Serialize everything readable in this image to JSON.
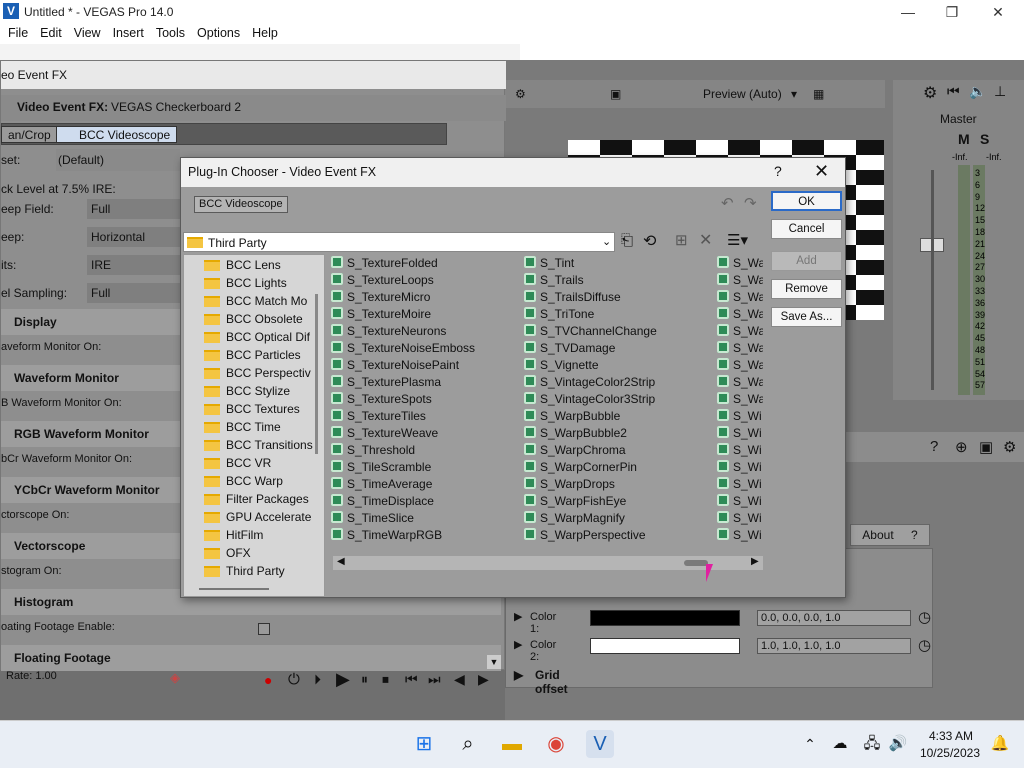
{
  "window": {
    "title": "Untitled * - VEGAS Pro 14.0",
    "minimize": "—",
    "restore": "❐",
    "close": "✕"
  },
  "menu": [
    "File",
    "Edit",
    "View",
    "Insert",
    "Tools",
    "Options",
    "Help"
  ],
  "preview": {
    "quality": "Preview (Auto)"
  },
  "mixer": {
    "label": "Master",
    "solo_label": "M",
    "s_label": "S",
    "scale": [
      "-Inf.",
      "-Inf.",
      "3",
      "6",
      "9",
      "12",
      "15",
      "18",
      "21",
      "24",
      "27",
      "30",
      "33",
      "36",
      "39",
      "42",
      "45",
      "48",
      "51",
      "54",
      "57"
    ]
  },
  "vefx": {
    "title": "eo Event FX",
    "header_label": "Video Event FX:",
    "header_value": "VEGAS Checkerboard 2",
    "chain": [
      "an/Crop",
      "BCC Videoscope"
    ],
    "preset_label": "set:",
    "preset_value": "(Default)",
    "rows": [
      {
        "label": "ck Level at 7.5% IRE:",
        "value": ""
      },
      {
        "label": "eep Field:",
        "value": "Full"
      },
      {
        "label": "eep:",
        "value": "Horizontal"
      },
      {
        "label": "its:",
        "value": "IRE"
      },
      {
        "label": "el Sampling:",
        "value": "Full"
      }
    ],
    "sections": [
      {
        "title": "Display",
        "sub": "aveform Monitor On:"
      },
      {
        "title": "Waveform Monitor",
        "sub": "B Waveform Monitor On:"
      },
      {
        "title": "RGB Waveform Monitor",
        "sub": "bCr Waveform Monitor On:"
      },
      {
        "title": "YCbCr Waveform Monitor",
        "sub": "ctorscope On:"
      },
      {
        "title": "Vectorscope",
        "sub": "stogram On:"
      },
      {
        "title": "Histogram",
        "sub": "oating Footage Enable:"
      },
      {
        "title": "Floating Footage",
        "sub": ""
      }
    ],
    "rate": "Rate: 1.00"
  },
  "dialog": {
    "title": "Plug-In Chooser - Video Event FX",
    "help": "?",
    "close": "✕",
    "chip": "BCC Videoscope",
    "path": "Third Party",
    "buttons": {
      "ok": "OK",
      "cancel": "Cancel",
      "add": "Add",
      "remove": "Remove",
      "save_as": "Save As..."
    },
    "tree": [
      "BCC Lens",
      "BCC Lights",
      "BCC Match Mo",
      "BCC Obsolete",
      "BCC Optical Dif",
      "BCC Particles",
      "BCC Perspectiv",
      "BCC Stylize",
      "BCC Textures",
      "BCC Time",
      "BCC Transitions",
      "BCC VR",
      "BCC Warp",
      "Filter Packages",
      "GPU Accelerate",
      "HitFilm",
      "OFX",
      "Third Party"
    ],
    "col1": [
      "S_TextureFolded",
      "S_TextureLoops",
      "S_TextureMicro",
      "S_TextureMoire",
      "S_TextureNeurons",
      "S_TextureNoiseEmboss",
      "S_TextureNoisePaint",
      "S_TexturePlasma",
      "S_TextureSpots",
      "S_TextureTiles",
      "S_TextureWeave",
      "S_Threshold",
      "S_TileScramble",
      "S_TimeAverage",
      "S_TimeDisplace",
      "S_TimeSlice",
      "S_TimeWarpRGB"
    ],
    "col2": [
      "S_Tint",
      "S_Trails",
      "S_TrailsDiffuse",
      "S_TriTone",
      "S_TVChannelChange",
      "S_TVDamage",
      "S_Vignette",
      "S_VintageColor2Strip",
      "S_VintageColor3Strip",
      "S_WarpBubble",
      "S_WarpBubble2",
      "S_WarpChroma",
      "S_WarpCornerPin",
      "S_WarpDrops",
      "S_WarpFishEye",
      "S_WarpMagnify",
      "S_WarpPerspective"
    ],
    "col3": [
      "S_Wa",
      "S_Wa",
      "S_Wa",
      "S_Wa",
      "S_Wa",
      "S_Wa",
      "S_Wa",
      "S_Wa",
      "S_Wa",
      "S_Wi",
      "S_Wi",
      "S_Wi",
      "S_Wi",
      "S_Wi",
      "S_Wi",
      "S_Wi",
      "S_Wi"
    ]
  },
  "params": {
    "about": "About",
    "about_q": "?",
    "color1_label": "Color 1:",
    "color1_value": "0.0, 0.0, 0.0, 1.0",
    "color1_hex": "#000000",
    "color2_label": "Color 2:",
    "color2_value": "1.0, 1.0, 1.0, 1.0",
    "color2_hex": "#ffffff",
    "grid_offset": "Grid offset"
  },
  "taskbar": {
    "time": "4:33 AM",
    "date": "10/25/2023"
  }
}
